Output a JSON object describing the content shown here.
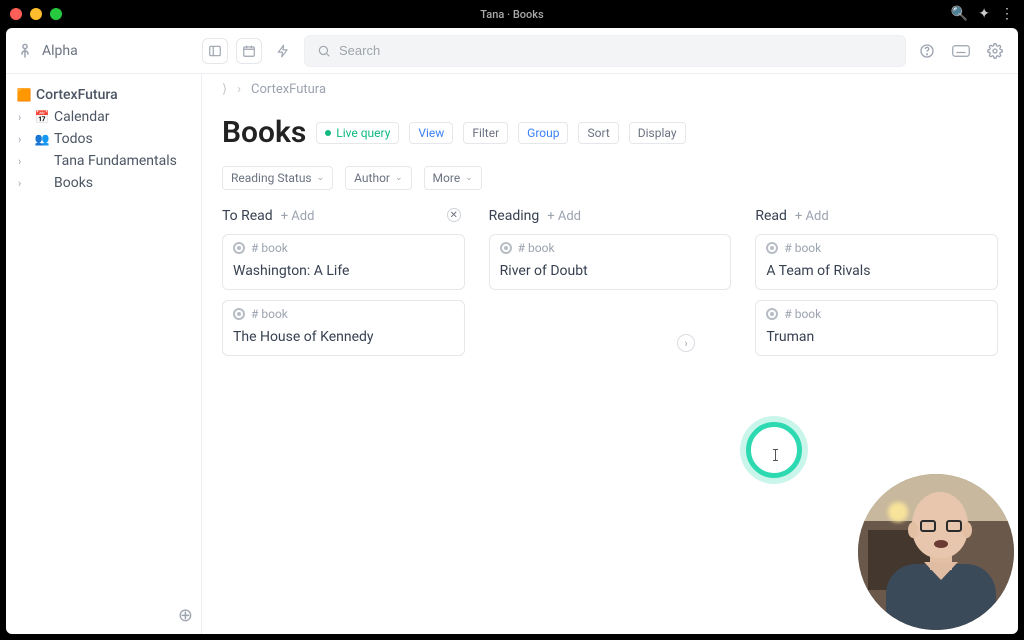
{
  "window": {
    "title": "Tana · Books"
  },
  "brand": {
    "name": "Alpha"
  },
  "search": {
    "placeholder": "Search"
  },
  "sidebar": {
    "root": "CortexFutura",
    "items": [
      {
        "icon": "📅",
        "label": "Calendar"
      },
      {
        "icon": "👥",
        "label": "Todos"
      },
      {
        "icon": "",
        "label": "Tana Fundamentals"
      },
      {
        "icon": "",
        "label": "Books"
      }
    ]
  },
  "breadcrumb": {
    "root_sep": "›",
    "items": [
      "CortexFutura"
    ]
  },
  "page": {
    "title": "Books",
    "chips": {
      "live": "Live query",
      "view": "View",
      "filter": "Filter",
      "group": "Group",
      "sort": "Sort",
      "display": "Display"
    }
  },
  "filters": [
    {
      "label": "Reading Status"
    },
    {
      "label": "Author"
    },
    {
      "label": "More"
    }
  ],
  "tag_label": "# book",
  "add_label": "+  Add",
  "columns": [
    {
      "name": "To Read",
      "has_clear": true,
      "cards": [
        {
          "title": "Washington: A Life"
        },
        {
          "title": "The House of Kennedy"
        }
      ]
    },
    {
      "name": "Reading",
      "has_clear": false,
      "cards": [
        {
          "title": "River of Doubt"
        }
      ]
    },
    {
      "name": "Read",
      "has_clear": false,
      "cards": [
        {
          "title": "A Team of Rivals"
        },
        {
          "title": "Truman"
        }
      ]
    }
  ]
}
